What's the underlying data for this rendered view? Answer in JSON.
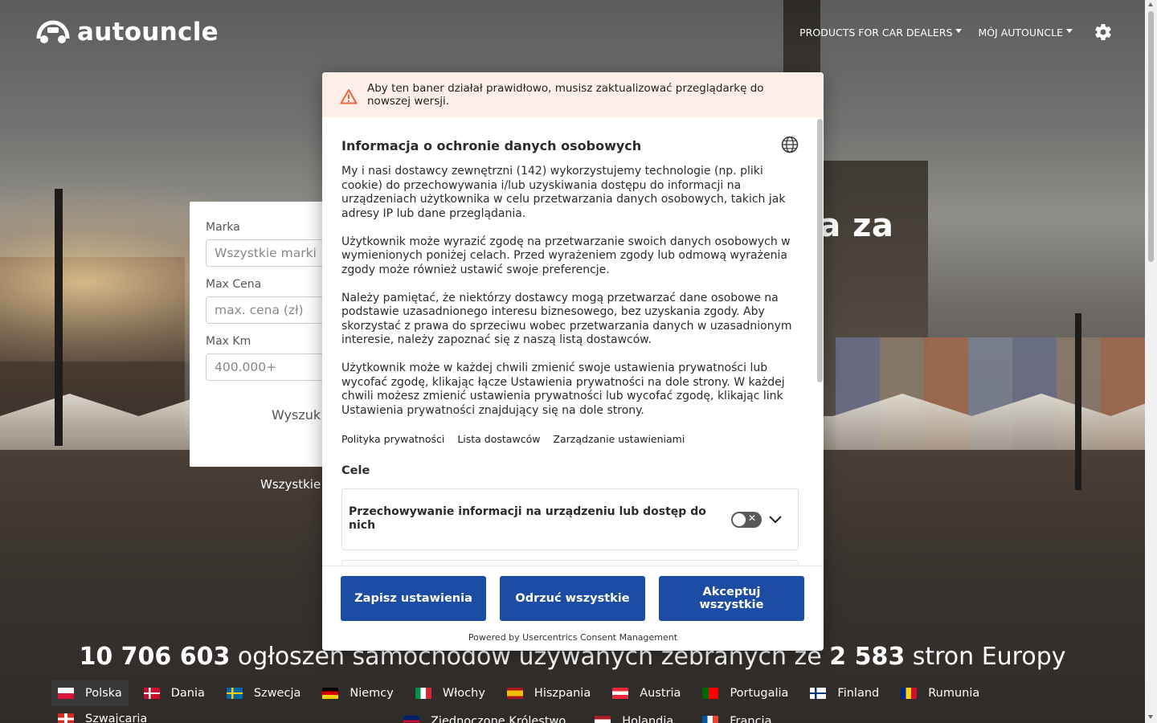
{
  "header": {
    "logo_text": "autouncle",
    "nav": {
      "products": "PRODUCTS FOR CAR DEALERS",
      "my_account": "MÓJ AUTOUNCLE"
    }
  },
  "search": {
    "brand_label": "Marka",
    "brand_placeholder": "Wszystkie marki",
    "price_label": "Max Cena",
    "price_placeholder": "max. cena (zł)",
    "km_label": "Max Km",
    "km_placeholder": "400.000+",
    "search_button": "Wyszuk",
    "all_link": "Wszystkie"
  },
  "hero": {
    "title_fragment": "ia za"
  },
  "stats": {
    "count": "10 706 603",
    "text_mid": " ogłoszeń samochodów używanych zebranych ze ",
    "sites": "2 583",
    "text_end": " stron Europy"
  },
  "countries": [
    {
      "name": "Polska",
      "active": true,
      "flag": "pl"
    },
    {
      "name": "Dania",
      "active": false,
      "flag": "dk"
    },
    {
      "name": "Szwecja",
      "active": false,
      "flag": "se"
    },
    {
      "name": "Niemcy",
      "active": false,
      "flag": "de"
    },
    {
      "name": "Włochy",
      "active": false,
      "flag": "it"
    },
    {
      "name": "Hiszpania",
      "active": false,
      "flag": "es"
    },
    {
      "name": "Austria",
      "active": false,
      "flag": "at"
    },
    {
      "name": "Portugalia",
      "active": false,
      "flag": "pt"
    },
    {
      "name": "Finland",
      "active": false,
      "flag": "fi"
    },
    {
      "name": "Rumunia",
      "active": false,
      "flag": "ro"
    },
    {
      "name": "Szwajcaria",
      "active": false,
      "flag": "ch"
    }
  ],
  "countries_row2": [
    {
      "name": "Zjednoczone Królestwo",
      "flag": "uk"
    },
    {
      "name": "Holandia",
      "flag": "nl"
    },
    {
      "name": "Francja",
      "flag": "fr"
    }
  ],
  "consent": {
    "warning": "Aby ten baner działał prawidłowo, musisz zaktualizować przeglądarkę do nowszej wersji.",
    "title": "Informacja o ochronie danych osobowych",
    "paragraphs": [
      "My i nasi dostawcy zewnętrzni (142) wykorzystujemy technologie (np. pliki cookie) do przechowywania i/lub uzyskiwania dostępu do informacji na urządzeniach użytkownika w celu przetwarzania danych osobowych, takich jak adresy IP lub dane przeglądania.",
      "Użytkownik może wyrazić zgodę na przetwarzanie swoich danych osobowych w wymienionych poniżej celach. Przed wyrażeniem zgody lub odmową wyrażenia zgody może również ustawić swoje preferencje.",
      "Należy pamiętać, że niektórzy dostawcy mogą przetwarzać dane osobowe na podstawie uzasadnionego interesu biznesowego, bez uzyskania zgody. Aby skorzystać z prawa do sprzeciwu wobec przetwarzania danych w uzasadnionym interesie, należy zapoznać się z naszą listą dostawców.",
      "Użytkownik może w każdej chwili zmienić swoje ustawienia prywatności lub wycofać zgodę, klikając łącze Ustawienia prywatności na dole strony. W każdej chwili możesz zmienić ustawienia prywatności lub wycofać zgodę, klikając link Ustawienia prywatności znajdujący się na dole strony."
    ],
    "links": {
      "privacy": "Polityka prywatności",
      "vendors": "Lista dostawców",
      "manage": "Zarządzanie ustawieniami"
    },
    "purposes_title": "Cele",
    "purpose_1": "Przechowywanie informacji na urządzeniu lub dostęp do nich",
    "purpose_1_enabled": false,
    "buttons": {
      "save": "Zapisz ustawienia",
      "reject": "Odrzuć wszystkie",
      "accept": "Akceptuj wszystkie"
    },
    "powered_by": "Powered by Usercentrics Consent Management"
  },
  "colors": {
    "primary_button": "#1d4ca4",
    "warning_bg": "#fdefe7",
    "warning_icon": "#e8663d"
  }
}
